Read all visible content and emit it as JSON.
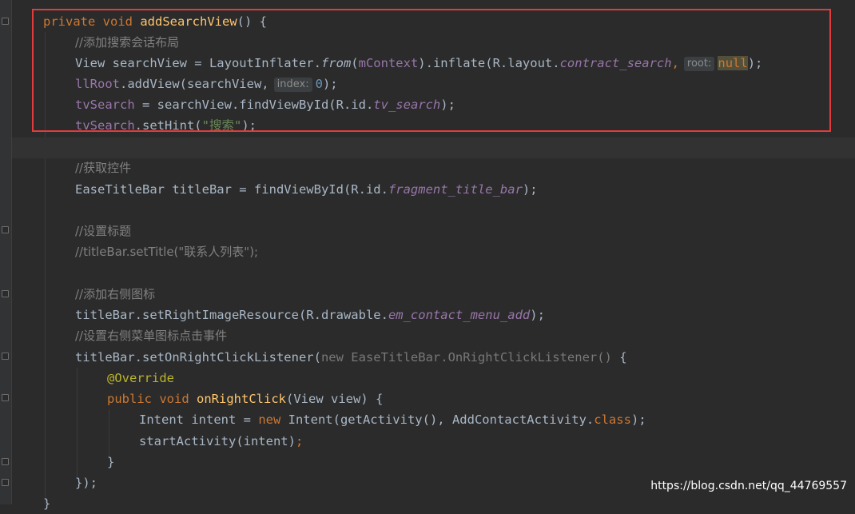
{
  "lines": {
    "l1": {
      "kw1": "private",
      "kw2": "void",
      "fn": "addSearchView",
      "rest": "() {"
    },
    "l2": {
      "comment": "//添加搜索会话布局"
    },
    "l3": {
      "a": "View searchView = LayoutInflater.",
      "b": "from",
      "c": "(",
      "d": "mContext",
      "e": ").inflate(R.layout.",
      "f": "contract_search",
      "g": ",",
      "hint": "root:",
      "h": "null",
      "i": ");"
    },
    "l4": {
      "a": "llRoot",
      "b": ".addView(searchView,",
      "hint": "index:",
      "num": "0",
      "c": ");"
    },
    "l5": {
      "a": "tvSearch",
      "b": " = searchView.findViewById(R.id.",
      "c": "tv_search",
      "d": ");"
    },
    "l6": {
      "a": "tvSearch",
      "b": ".setHint(",
      "str": "\"搜索\"",
      "c": ");"
    },
    "l8": {
      "comment": "//获取控件"
    },
    "l9": {
      "a": "EaseTitleBar titleBar = findViewById(R.id.",
      "b": "fragment_title_bar",
      "c": ");"
    },
    "l11": {
      "comment": "//设置标题"
    },
    "l12": {
      "comment": "//titleBar.setTitle(\"联系人列表\");"
    },
    "l14": {
      "comment": "//添加右侧图标"
    },
    "l15": {
      "a": "titleBar.setRightImageResource(R.drawable.",
      "b": "em_contact_menu_add",
      "c": ");"
    },
    "l16": {
      "comment": "//设置右侧菜单图标点击事件"
    },
    "l17": {
      "a": "titleBar.setOnRightClickListener(",
      "gray": "new EaseTitleBar.OnRightClickListener()",
      "b": " {"
    },
    "l18": {
      "ann": "@Override"
    },
    "l19": {
      "kw1": "public",
      "kw2": "void",
      "fn": "onRightClick",
      "rest": "(View view) {"
    },
    "l20": {
      "a": "Intent intent = ",
      "kw": "new",
      "b": " Intent(getActivity(),",
      "c": " AddContactActivity.",
      "kw2": "class",
      "d": ");"
    },
    "l21": {
      "a": "startActivity(intent)",
      "b": ";"
    },
    "l22": {
      "a": "}"
    },
    "l23": {
      "a": "});"
    },
    "l24": {
      "a": "}"
    }
  },
  "watermark": "https://blog.csdn.net/qq_44769557",
  "colors": {
    "background": "#2b2b2b",
    "keyword": "#cc7832",
    "method": "#ffc66d",
    "field": "#9876aa",
    "string": "#6a8759",
    "number": "#6897bb",
    "comment": "#808080",
    "annotation": "#bbb529",
    "highlight_box": "#e23b3b"
  }
}
